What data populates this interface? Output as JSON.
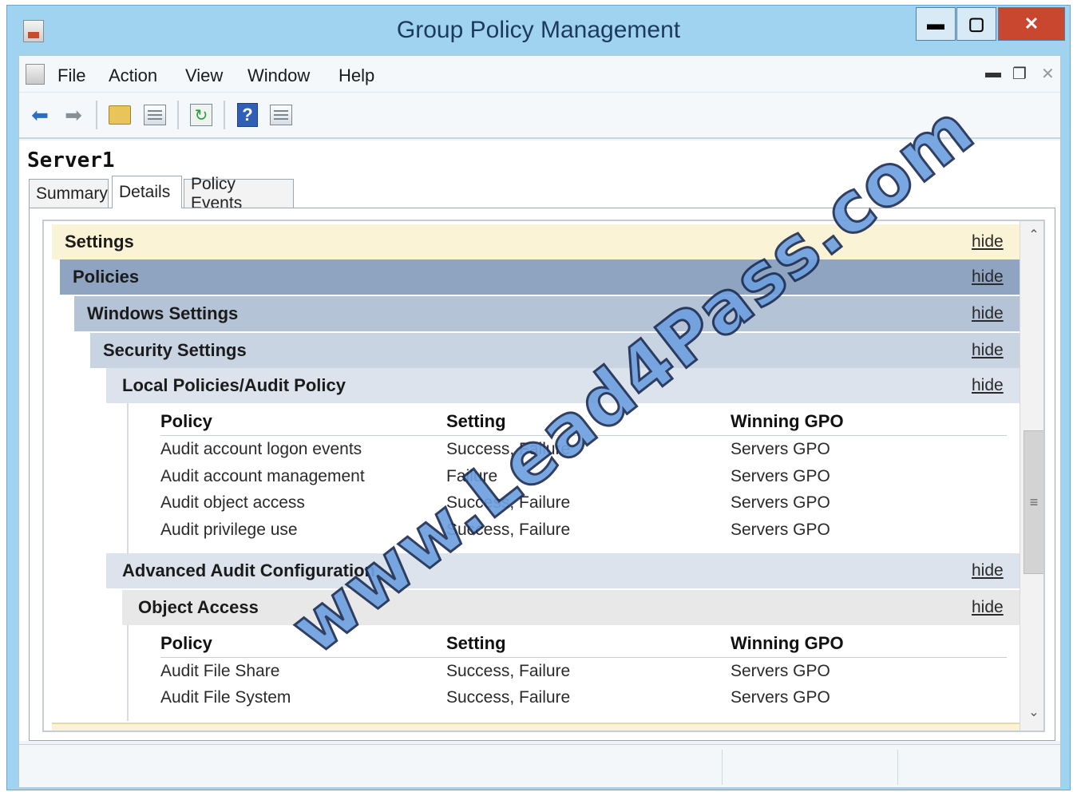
{
  "window": {
    "title": "Group Policy Management",
    "controls": {
      "minimize": "▬",
      "maximize": "▢",
      "close": "✕"
    }
  },
  "menu": {
    "items": [
      "File",
      "Action",
      "View",
      "Window",
      "Help"
    ],
    "mdi_controls": {
      "minimize": "▬",
      "restore": "❐",
      "close": "✕"
    }
  },
  "toolbar": {
    "icons": [
      "back-arrow-icon",
      "forward-arrow-icon",
      "up-folder-icon",
      "show-hide-tree-icon",
      "refresh-icon",
      "help-icon",
      "properties-icon"
    ]
  },
  "page": {
    "server_name": "Server1",
    "tabs": [
      {
        "label": "Summary",
        "active": false
      },
      {
        "label": "Details",
        "active": true
      },
      {
        "label": "Policy Events",
        "active": false
      }
    ]
  },
  "report": {
    "hide_label": "hide",
    "sections": {
      "settings": "Settings",
      "policies": "Policies",
      "windows_settings": "Windows Settings",
      "security_settings": "Security Settings",
      "audit_policy": "Local Policies/Audit Policy",
      "advanced_audit": "Advanced Audit Configuration",
      "object_access": "Object Access"
    },
    "columns": {
      "policy": "Policy",
      "setting": "Setting",
      "winning_gpo": "Winning GPO"
    },
    "audit_policy_rows": [
      {
        "policy": "Audit account logon events",
        "setting": "Success, Failure",
        "gpo": "Servers GPO"
      },
      {
        "policy": "Audit account management",
        "setting": "Failure",
        "gpo": "Servers GPO"
      },
      {
        "policy": "Audit object access",
        "setting": "Success, Failure",
        "gpo": "Servers GPO"
      },
      {
        "policy": "Audit privilege use",
        "setting": "Success, Failure",
        "gpo": "Servers GPO"
      }
    ],
    "object_access_rows": [
      {
        "policy": "Audit File Share",
        "setting": "Success, Failure",
        "gpo": "Servers GPO"
      },
      {
        "policy": "Audit File System",
        "setting": "Success, Failure",
        "gpo": "Servers GPO"
      }
    ]
  },
  "watermark": "www.Lead4Pass.com",
  "colors": {
    "title_bar": "#9fd3f0",
    "settings_header": "#fbf3d5",
    "policies_header": "#8ea4c0",
    "windows_settings_header": "#b4c3d6",
    "security_settings_header": "#c8d4e2",
    "subsection_header": "#dde3ec",
    "object_access_header": "#e8e8e8",
    "close_button": "#c9462f"
  }
}
